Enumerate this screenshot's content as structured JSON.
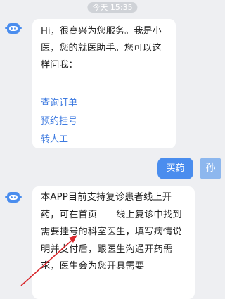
{
  "header": {
    "timestamp": "今天 15:35"
  },
  "bot": {
    "avatar_icon": "robot-icon",
    "greeting_text": "Hi，很高兴为您服务。我是小医，您的就医助手。您可以这样问我：",
    "quick_links": [
      {
        "label": "查询订单"
      },
      {
        "label": "预约挂号"
      },
      {
        "label": "转人工"
      }
    ]
  },
  "user": {
    "message": "买药",
    "avatar_text": "孙"
  },
  "bot_reply": {
    "text": "本APP目前支持复诊患者线上开药，可在首页——线上复诊中找到需要挂号的科室医生，填写病情说明并支付后，跟医生沟通开药需求，医生会为您开具需要"
  },
  "colors": {
    "background": "#eeeff2",
    "link": "#3d7ae0",
    "user_bubble": "#4a8dee",
    "annotation_arrow": "#d9262b"
  }
}
